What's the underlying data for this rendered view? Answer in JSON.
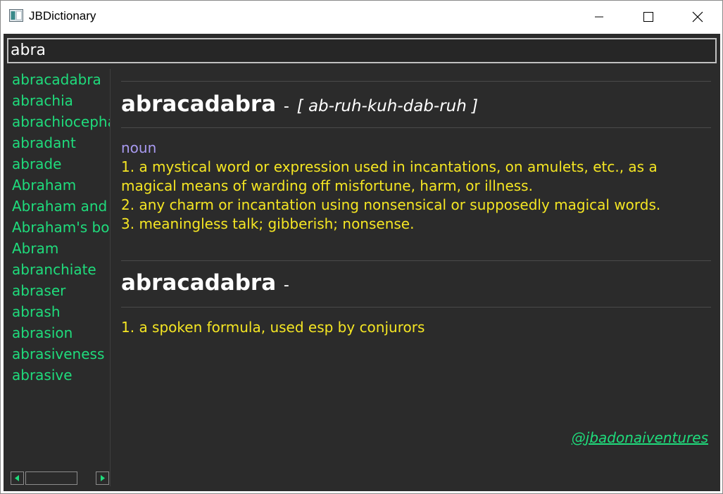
{
  "window": {
    "title": "JBDictionary",
    "icon": "app-window-icon"
  },
  "search": {
    "value": "abra"
  },
  "word_list": [
    "abracadabra",
    "abrachia",
    "abrachiocephalus",
    "abradant",
    "abrade",
    "Abraham",
    "Abraham and Isaac",
    "Abraham's bosom",
    "Abram",
    "abranchiate",
    "abraser",
    "abrash",
    "abrasion",
    "abrasiveness",
    "abrasive"
  ],
  "entries": [
    {
      "headword": "abracadabra",
      "dash": "-",
      "pronunciation": "[ ab-ruh-kuh-dab-ruh ]",
      "part_of_speech": "noun",
      "senses": [
        "1. a mystical word or expression used in incantations, on amulets, etc., as a magical means of warding off misfortune, harm, or illness.",
        "2. any charm or incantation using nonsensical or supposedly magical words.",
        "3. meaningless talk; gibberish; nonsense."
      ]
    },
    {
      "headword": "abracadabra",
      "dash": "-",
      "senses": [
        "1. a spoken formula, used esp by conjurors"
      ]
    }
  ],
  "credit": "@jbadonaiventures",
  "colors": {
    "background": "#2b2b2b",
    "list_text": "#1fdc7c",
    "sense_text": "#f5e623",
    "pos_text": "#a89af0",
    "headword": "#ffffff"
  }
}
